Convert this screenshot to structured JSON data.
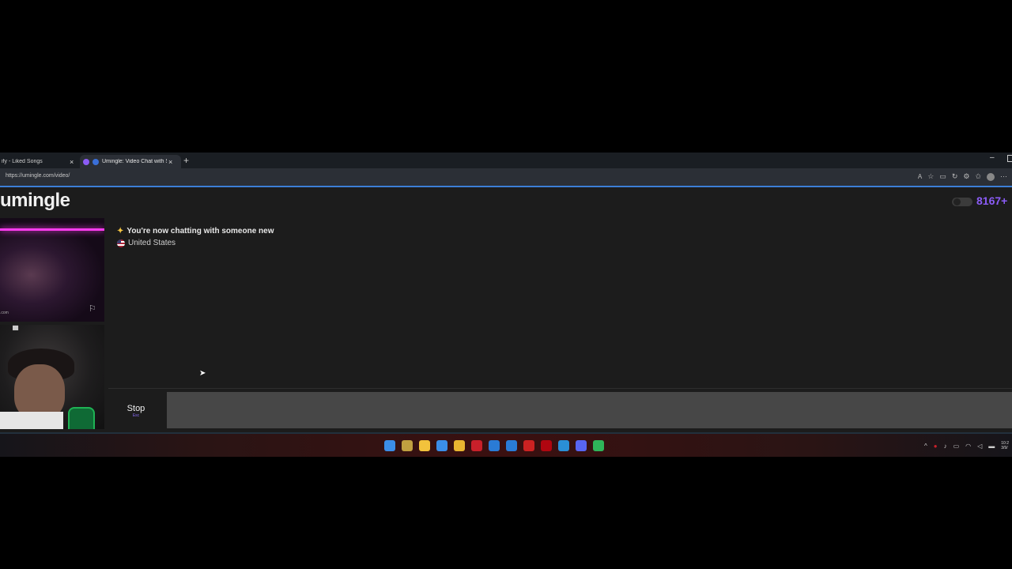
{
  "browser": {
    "tabs": [
      {
        "title": "ify - Liked Songs",
        "icon_color": "#1db954"
      },
      {
        "title": "Umingle: Video Chat with Str",
        "icon_color": "#8b5cf6"
      }
    ],
    "new_tab_glyph": "+",
    "close_glyph": "×",
    "url": "https://umingle.com/video/"
  },
  "site": {
    "logo": "umingle",
    "online_count": "8167+",
    "accent": "#8b5cf6"
  },
  "chat": {
    "status_message": "You're now chatting with someone new",
    "country": "United States"
  },
  "controls": {
    "stop_label": "Stop",
    "stop_shortcut": "Esc",
    "message_placeholder": ""
  },
  "remote_video": {
    "watermark": ".com"
  },
  "taskbar": {
    "apps": [
      "windows-start",
      "copilot",
      "file-explorer",
      "microsoft-store",
      "chrome",
      "mcafee",
      "app-blue",
      "outlook",
      "youtube",
      "netflix",
      "edge",
      "discord",
      "xbox"
    ],
    "app_colors": [
      "#3b8ee8",
      "#c0a040",
      "#f2c23c",
      "#3b8ee8",
      "#e8b530",
      "#c8202a",
      "#2a7bd6",
      "#2a7bd6",
      "#cc2222",
      "#b00610",
      "#2a8fd6",
      "#5865f2",
      "#2fb55a"
    ],
    "clock_time": "10:2",
    "clock_date": "3/9/"
  }
}
